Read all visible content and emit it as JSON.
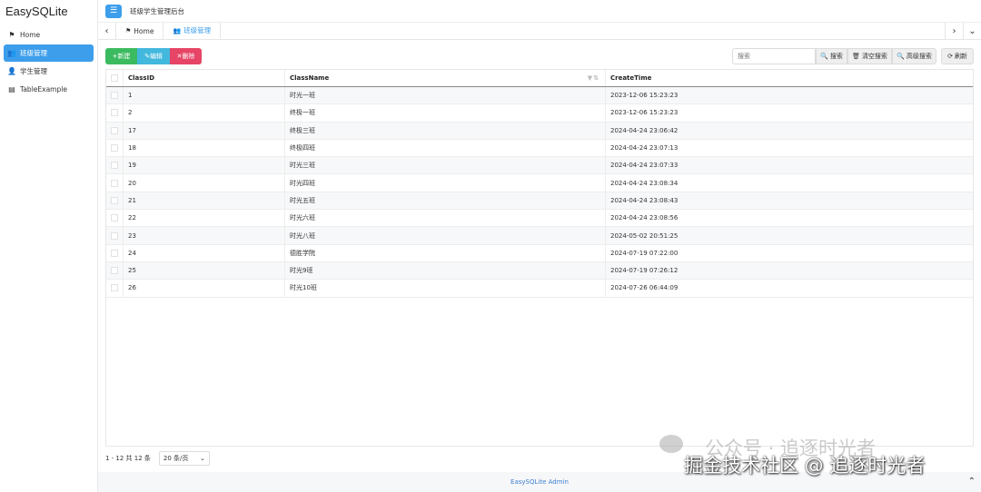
{
  "app": {
    "brand": "EasySQLite",
    "top_title": "班级学生管理后台",
    "footer": "EasySQLite Admin"
  },
  "sidebar": {
    "items": [
      {
        "label": "Home",
        "icon": "flag-icon"
      },
      {
        "label": "班级管理",
        "icon": "users-icon",
        "active": true
      },
      {
        "label": "学生管理",
        "icon": "user-icon"
      },
      {
        "label": "TableExample",
        "icon": "document-icon"
      }
    ]
  },
  "tabs": [
    {
      "label": "Home",
      "icon": "flag-icon"
    },
    {
      "label": "班级管理",
      "icon": "users-icon",
      "active": true
    }
  ],
  "toolbar": {
    "new_label": "新建",
    "edit_label": "编辑",
    "delete_label": "删除",
    "search_placeholder": "搜索",
    "search_label": "搜索",
    "clear_label": "清空搜索",
    "advanced_label": "高级搜索",
    "refresh_label": "刷新"
  },
  "table": {
    "columns": [
      "ClassID",
      "ClassName",
      "CreateTime"
    ],
    "rows": [
      {
        "id": "1",
        "name": "时光一班",
        "time": "2023-12-06 15:23:23"
      },
      {
        "id": "2",
        "name": "终极一班",
        "time": "2023-12-06 15:23:23"
      },
      {
        "id": "17",
        "name": "终极三班",
        "time": "2024-04-24 23:06:42"
      },
      {
        "id": "18",
        "name": "终极四班",
        "time": "2024-04-24 23:07:13"
      },
      {
        "id": "19",
        "name": "时光三班",
        "time": "2024-04-24 23:07:33"
      },
      {
        "id": "20",
        "name": "时光四班",
        "time": "2024-04-24 23:08:34"
      },
      {
        "id": "21",
        "name": "时光五班",
        "time": "2024-04-24 23:08:43"
      },
      {
        "id": "22",
        "name": "时光六班",
        "time": "2024-04-24 23:08:56"
      },
      {
        "id": "23",
        "name": "时光八班",
        "time": "2024-05-02 20:51:25"
      },
      {
        "id": "24",
        "name": "德胜学院",
        "time": "2024-07-19 07:22:00"
      },
      {
        "id": "25",
        "name": "时光9班",
        "time": "2024-07-19 07:26:12"
      },
      {
        "id": "26",
        "name": "时光10班",
        "time": "2024-07-26 06:44:09"
      }
    ]
  },
  "pager": {
    "summary": "1 - 12 共 12 条",
    "page_size": "20 条/页"
  },
  "watermark": {
    "line1": "公众号 · 追逐时光者",
    "line2": "掘金技术社区 @ 追逐时光者"
  },
  "colors": {
    "accent": "#3d9eeb",
    "new": "#3cba60",
    "edit": "#42b8dd",
    "delete": "#e64566"
  }
}
